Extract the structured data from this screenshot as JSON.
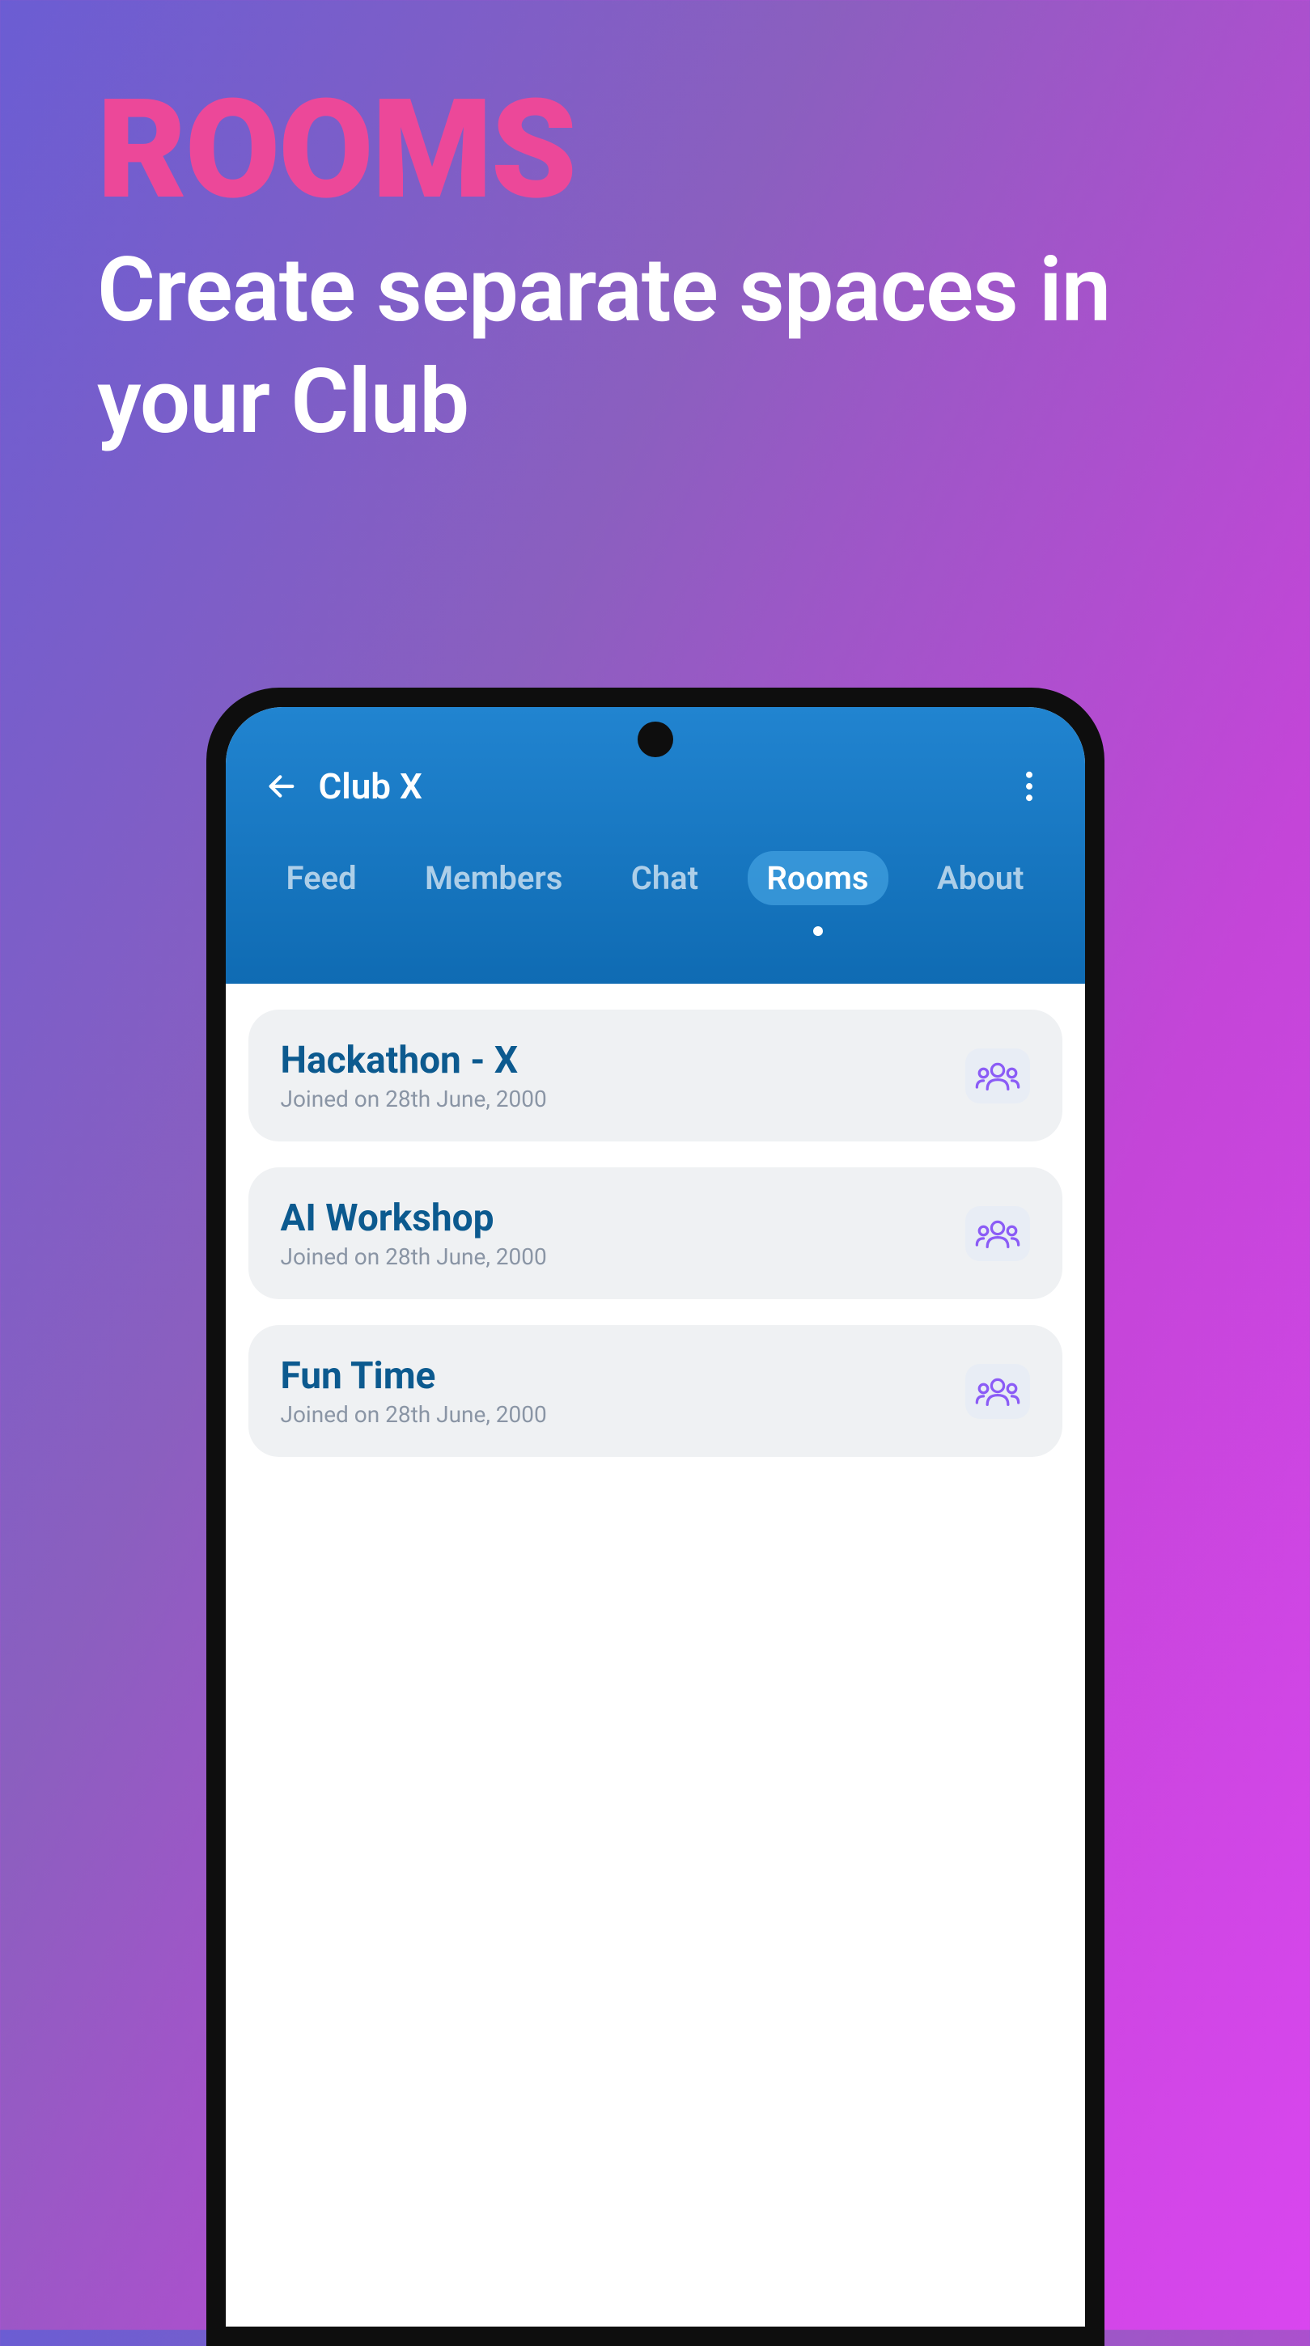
{
  "promo": {
    "title": "ROOMS",
    "subtitle": "Create separate spaces in your Club"
  },
  "header": {
    "title": "Club X"
  },
  "tabs": [
    {
      "label": "Feed",
      "active": false
    },
    {
      "label": "Members",
      "active": false
    },
    {
      "label": "Chat",
      "active": false
    },
    {
      "label": "Rooms",
      "active": true
    },
    {
      "label": "About",
      "active": false
    }
  ],
  "rooms": [
    {
      "title": "Hackathon - X",
      "subtitle": "Joined on 28th June, 2000"
    },
    {
      "title": "AI Workshop",
      "subtitle": "Joined on 28th June, 2000"
    },
    {
      "title": "Fun Time",
      "subtitle": "Joined on 28th June, 2000"
    }
  ],
  "colors": {
    "accent": "#EC4899",
    "headerBg": "#1470B5",
    "roomTitle": "#0C5A8F",
    "iconPurple": "#8B5CF6"
  }
}
